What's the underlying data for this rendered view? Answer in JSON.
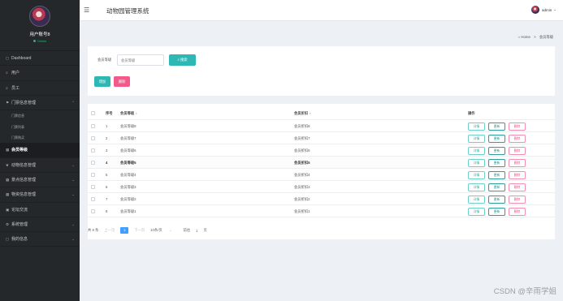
{
  "sidebar": {
    "username": "用户账号8",
    "status": "Online",
    "items": [
      {
        "icon": "dashboard-icon",
        "glyph": "◻",
        "label": "Dashboard",
        "expandable": false
      },
      {
        "icon": "user-icon",
        "glyph": "≡",
        "label": "用户",
        "expandable": false
      },
      {
        "icon": "staff-icon",
        "glyph": "≡",
        "label": "员工",
        "expandable": false
      },
      {
        "icon": "flag-icon",
        "glyph": "⚑",
        "label": "门票信息管理",
        "expandable": true,
        "expanded": true,
        "children": [
          {
            "label": "门票信息"
          },
          {
            "label": "门票列表"
          },
          {
            "label": "门票购买"
          }
        ]
      },
      {
        "icon": "grid-icon",
        "glyph": "▦",
        "label": "会员等级",
        "expandable": false,
        "active": true
      },
      {
        "icon": "paw-icon",
        "glyph": "❦",
        "label": "动物信息管理",
        "expandable": true
      },
      {
        "icon": "grid-icon",
        "glyph": "▦",
        "label": "景点信息管理",
        "expandable": true
      },
      {
        "icon": "grid-icon",
        "glyph": "▦",
        "label": "物资信息管理",
        "expandable": true
      },
      {
        "icon": "chat-icon",
        "glyph": "▣",
        "label": "论坛交流",
        "expandable": false
      },
      {
        "icon": "gear-icon",
        "glyph": "⚙",
        "label": "系统管理",
        "expandable": true
      },
      {
        "icon": "info-icon",
        "glyph": "◻",
        "label": "我的信息",
        "expandable": true
      }
    ]
  },
  "header": {
    "menu_icon": "☰",
    "title": "动物园管理系统",
    "user": "admin",
    "user_caret": "⌄"
  },
  "breadcrumb": {
    "home_icon": "⌂",
    "home": "Home",
    "sep": ">",
    "current": "会员等级"
  },
  "search": {
    "label": "会员等级",
    "placeholder": "会员等级",
    "button_icon": "⌕",
    "button": "搜索"
  },
  "actions": {
    "add": "增加",
    "delete": "删除"
  },
  "table": {
    "headers": {
      "index": "序号",
      "account": "会员等级",
      "points": "会员折扣",
      "ops": "操作"
    },
    "sort_glyph": "⇕",
    "rows": [
      {
        "index": "1",
        "account": "会员等级8",
        "points": "会员折扣8"
      },
      {
        "index": "2",
        "account": "会员等级7",
        "points": "会员折扣7"
      },
      {
        "index": "3",
        "account": "会员等级6",
        "points": "会员折扣6"
      },
      {
        "index": "4",
        "account": "会员等级5",
        "points": "会员折扣5",
        "highlight": true
      },
      {
        "index": "5",
        "account": "会员等级4",
        "points": "会员折扣4"
      },
      {
        "index": "6",
        "account": "会员等级3",
        "points": "会员折扣3"
      },
      {
        "index": "7",
        "account": "会员等级2",
        "points": "会员折扣2"
      },
      {
        "index": "8",
        "account": "会员等级1",
        "points": "会员折扣1"
      }
    ],
    "ops": {
      "detail": "详情",
      "update": "更新",
      "delete": "删除"
    }
  },
  "pagination": {
    "total": "共 8 条",
    "prev": "上一页",
    "page": "1",
    "next": "下一页",
    "size": "10条/页",
    "size_caret": "⌄",
    "goto": "前往",
    "goto_page": "1",
    "goto_suffix": "页"
  },
  "watermark": "CSDN @辛雨学姐",
  "colors": {
    "sidebar_bg": "#25282b",
    "teal": "#2db7b5",
    "pink": "#f25a8c",
    "page_active": "#409eff",
    "online": "#19be6b"
  }
}
